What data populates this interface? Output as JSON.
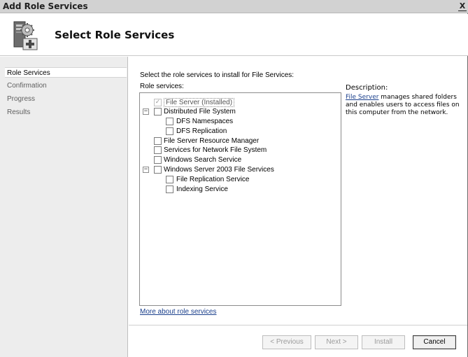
{
  "window": {
    "title": "Add Role Services",
    "close_label": "X"
  },
  "header": {
    "title": "Select Role Services",
    "icon": "server-roles-icon"
  },
  "nav": {
    "items": [
      {
        "label": "Role Services",
        "active": true
      },
      {
        "label": "Confirmation",
        "active": false
      },
      {
        "label": "Progress",
        "active": false
      },
      {
        "label": "Results",
        "active": false
      }
    ]
  },
  "main": {
    "intro": "Select the role services to install for File Services:",
    "list_label": "Role services:",
    "tree": [
      {
        "label": "File Server  (Installed)",
        "level": 1,
        "expander": "",
        "checked": true,
        "disabled": true,
        "selected": true
      },
      {
        "label": "Distributed File System",
        "level": 1,
        "expander": "−",
        "checked": false
      },
      {
        "label": "DFS Namespaces",
        "level": 2,
        "expander": "",
        "checked": false
      },
      {
        "label": "DFS Replication",
        "level": 2,
        "expander": "",
        "checked": false
      },
      {
        "label": "File Server Resource Manager",
        "level": 1,
        "expander": "",
        "checked": false
      },
      {
        "label": "Services for Network File System",
        "level": 1,
        "expander": "",
        "checked": false
      },
      {
        "label": "Windows Search Service",
        "level": 1,
        "expander": "",
        "checked": false
      },
      {
        "label": "Windows Server 2003 File Services",
        "level": 1,
        "expander": "−",
        "checked": false
      },
      {
        "label": "File Replication Service",
        "level": 2,
        "expander": "",
        "checked": false
      },
      {
        "label": "Indexing Service",
        "level": 2,
        "expander": "",
        "checked": false
      }
    ],
    "description_title": "Description:",
    "description_link": "File Server",
    "description_text": " manages shared folders and enables users to access files on this computer from the network.",
    "more_link": "More about role services"
  },
  "buttons": {
    "previous": "< Previous",
    "next": "Next >",
    "install": "Install",
    "cancel": "Cancel"
  }
}
